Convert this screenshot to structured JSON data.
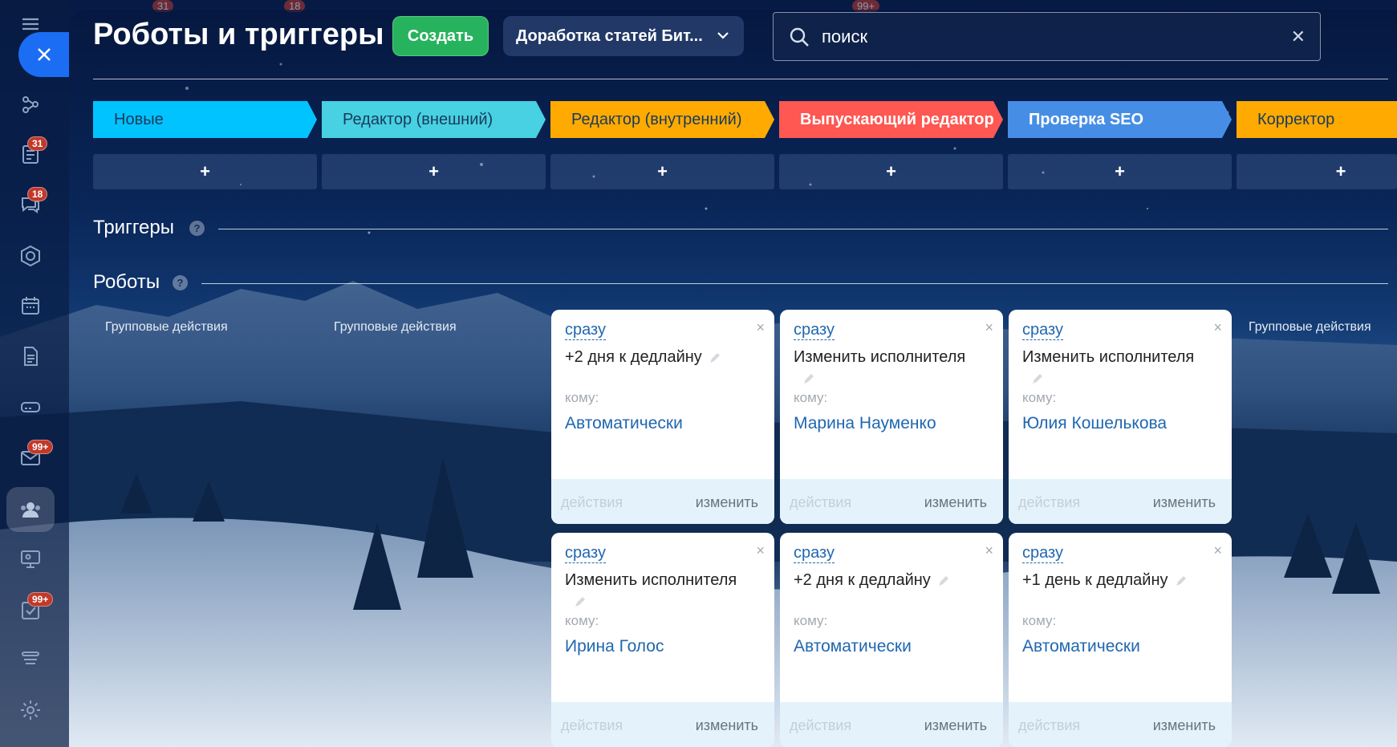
{
  "page": {
    "title": "Роботы и триггеры",
    "create_label": "Создать",
    "project_label": "Доработка статей Бит...",
    "search_placeholder": "поиск"
  },
  "sidebar": {
    "badges": {
      "tasks": "31",
      "chat": "18",
      "mail": "99+",
      "checklist": "99+"
    },
    "top_ghost_badges": [
      "31",
      "18",
      "99+"
    ]
  },
  "stages": [
    {
      "label": "Новые",
      "color": "#00c3ff",
      "text_color": "#1a3a5c"
    },
    {
      "label": "Редактор (внешний)",
      "color": "#47d1e2",
      "text_color": "#1a3a5c"
    },
    {
      "label": "Редактор (внутренний)",
      "color": "#ffaa00",
      "text_color": "#1a3a5c"
    },
    {
      "label": "Выпускающий редактор",
      "color": "#ff5752",
      "text_color": "#ffffff"
    },
    {
      "label": "Проверка SEO",
      "color": "#468ee5",
      "text_color": "#ffffff"
    },
    {
      "label": "Корректор",
      "color": "#ffaa00",
      "text_color": "#1a3a5c"
    }
  ],
  "add_label": "+",
  "sections": {
    "triggers": "Триггеры",
    "robots": "Роботы",
    "help": "?"
  },
  "group_actions_label": "Групповые действия",
  "card_labels": {
    "to": "кому:",
    "actions": "действия",
    "edit": "изменить",
    "close": "×"
  },
  "robots": [
    {
      "when": "сразу",
      "name": "+2 дня к дедлайну",
      "assignee": "Автоматически"
    },
    {
      "when": "сразу",
      "name": "Изменить исполнителя",
      "assignee": "Марина Науменко"
    },
    {
      "when": "сразу",
      "name": "Изменить исполнителя",
      "assignee": "Юлия Кошелькова"
    },
    {
      "when": "сразу",
      "name": "Изменить исполнителя",
      "assignee": "Ирина Голос"
    },
    {
      "when": "сразу",
      "name": "+2 дня к дедлайну",
      "assignee": "Автоматически"
    },
    {
      "when": "сразу",
      "name": "+1 день к дедлайну",
      "assignee": "Автоматически"
    }
  ],
  "colors": {
    "accent": "#2067b0",
    "create_button": "#27b35d",
    "close_button": "#1b6ef3"
  }
}
